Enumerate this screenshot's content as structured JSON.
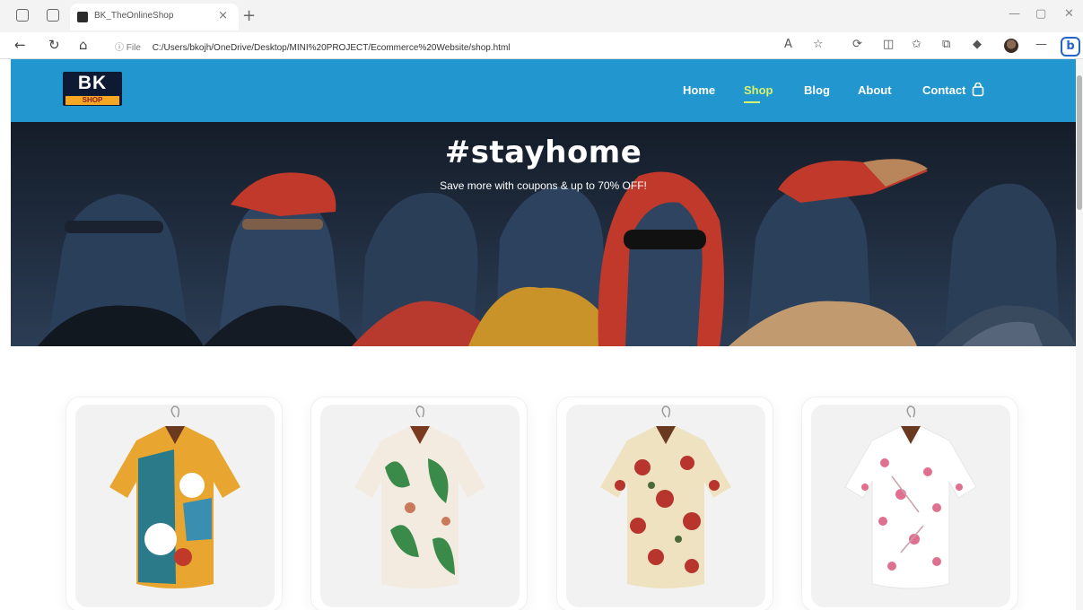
{
  "browser": {
    "tab_title": "BK_TheOnlineShop",
    "tab_close": "×",
    "new_tab": "+",
    "url_info": "ⓘ File",
    "url": "C:/Users/bkojh/OneDrive/Desktop/MINI%20PROJECT/Ecommerce%20Website/shop.html"
  },
  "site": {
    "logo": {
      "top": "BK",
      "bottom": "SHOP"
    },
    "nav": [
      {
        "label": "Home",
        "active": false
      },
      {
        "label": "Shop",
        "active": true
      },
      {
        "label": "Blog",
        "active": false
      },
      {
        "label": "About",
        "active": false
      },
      {
        "label": "Contact",
        "active": false
      }
    ],
    "cart_icon": "shopping-bag-icon"
  },
  "hero": {
    "title": "#stayhome",
    "subtitle": "Save more with coupons & up to 70% OFF!"
  },
  "products": [
    {
      "image": "colorful-floral-shirt",
      "colors": [
        "#e8a630",
        "#2a7a8a",
        "#ffffff",
        "#c0392b"
      ]
    },
    {
      "image": "tropical-leaf-shirt",
      "colors": [
        "#f3ebe0",
        "#3a8a4a",
        "#c97a5a"
      ]
    },
    {
      "image": "red-floral-cream-shirt",
      "colors": [
        "#efe2c0",
        "#b8352e",
        "#4a6a3a"
      ]
    },
    {
      "image": "pink-blossom-white-shirt",
      "colors": [
        "#ffffff",
        "#e07090",
        "#c9a0a8"
      ]
    }
  ],
  "colors": {
    "header_bg": "#2196cf",
    "nav_active": "#d6f26e",
    "hero_bg": "#1c2a3c"
  }
}
